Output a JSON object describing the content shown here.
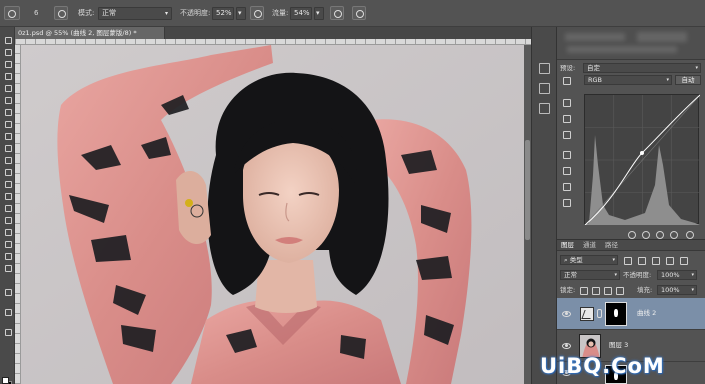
{
  "options_bar": {
    "mode_label": "模式:",
    "mode_value": "正常",
    "opacity_label": "不透明度:",
    "opacity_value": "52%",
    "flow_label": "流量:",
    "flow_value": "54%",
    "brush_size": "6"
  },
  "document": {
    "tab_title": "0z1.psd @ 55% (曲线 2, 图层蒙版/8) *"
  },
  "properties_panel": {
    "preset_label": "预设:",
    "preset_value": "自定",
    "channel_value": "RGB",
    "auto_button": "自动"
  },
  "layers_panel": {
    "tabs": [
      "图层",
      "通道",
      "路径"
    ],
    "filter_value": "类型",
    "blend_mode": "正常",
    "opacity_label": "不透明度:",
    "opacity_value": "100%",
    "lock_label": "锁定:",
    "fill_label": "填充:",
    "fill_value": "100%",
    "layers": [
      {
        "name": "曲线 2",
        "selected": true
      },
      {
        "name": "图层 3",
        "selected": false
      }
    ]
  },
  "watermark": {
    "text": "UiBQ.CoM",
    "color": "#ffffff",
    "glow": "#3d7fd0"
  },
  "colors": {
    "ui_bg": "#535353",
    "selected_layer": "#7b8fa8",
    "foreground_swatch": "#ffffff",
    "background_swatch": "#000000"
  }
}
